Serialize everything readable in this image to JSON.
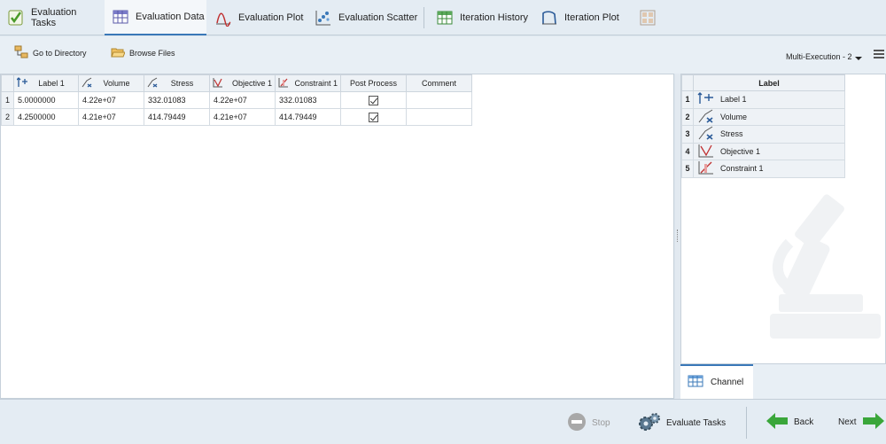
{
  "tabs": [
    {
      "label": "Evaluation Tasks",
      "icon": "checklist-icon",
      "active": false
    },
    {
      "label": "Evaluation Data",
      "icon": "data-table-icon",
      "active": true
    },
    {
      "label": "Evaluation Plot",
      "icon": "curve-plot-icon",
      "active": false
    },
    {
      "label": "Evaluation Scatter",
      "icon": "scatter-plot-icon",
      "active": false
    },
    {
      "label": "Iteration History",
      "icon": "history-table-icon",
      "active": false
    },
    {
      "label": "Iteration Plot",
      "icon": "iteration-plot-icon",
      "active": false
    }
  ],
  "toolbar": {
    "go_to_directory": "Go to Directory",
    "browse_files": "Browse Files",
    "multi_execution": "Multi-Execution - 2"
  },
  "table": {
    "columns": [
      "Label 1",
      "Volume",
      "Stress",
      "Objective 1",
      "Constraint 1",
      "Post Process",
      "Comment"
    ],
    "rows": [
      {
        "num": "1",
        "label": "5.0000000",
        "volume": "4.22e+07",
        "stress": "332.01083",
        "objective": "4.22e+07",
        "constraint": "332.01083",
        "post_process": true,
        "comment": ""
      },
      {
        "num": "2",
        "label": "4.2500000",
        "volume": "4.21e+07",
        "stress": "414.79449",
        "objective": "4.21e+07",
        "constraint": "414.79449",
        "post_process": true,
        "comment": ""
      }
    ]
  },
  "right_panel": {
    "header": "Label",
    "items": [
      {
        "num": "1",
        "label": "Label 1",
        "icon": "design-variable-icon"
      },
      {
        "num": "2",
        "label": "Volume",
        "icon": "response-icon"
      },
      {
        "num": "3",
        "label": "Stress",
        "icon": "response-icon"
      },
      {
        "num": "4",
        "label": "Objective 1",
        "icon": "objective-icon"
      },
      {
        "num": "5",
        "label": "Constraint 1",
        "icon": "constraint-icon"
      }
    ],
    "channel_tab": "Channel"
  },
  "bottom": {
    "stop": "Stop",
    "evaluate_tasks": "Evaluate Tasks",
    "back": "Back",
    "next": "Next"
  },
  "colors": {
    "accent": "#3a78b8",
    "green_arrow": "#3aa63a",
    "stop_gray": "#9a9a9a"
  }
}
